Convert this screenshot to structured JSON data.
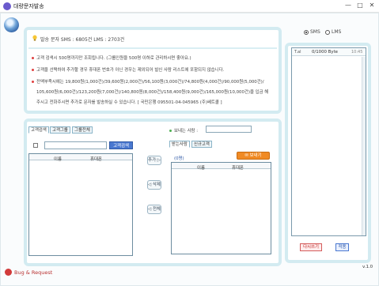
{
  "window": {
    "title": "대량문자발송",
    "minimize": "—",
    "maximize": "□",
    "close": "✕"
  },
  "info": {
    "sender": "발송 문자  SMS : 6805건  LMS : 2703건",
    "notes": [
      "고객 검색시 500명까지만 조회됩니다. (그룹인원을 500명 이하로 관리하시면 좋아요.)",
      "고객을 선택하여 추가할 경우 휴대폰 번호가 아닌 경우는 제외되어 발신 사람 리스트에 포함되지 않습니다.",
      "전액부족시에는 19,800원(1,000건)/39,600원(2,000건)/56,100원(3,000건)/74,800원(4,000건)/90,000원(5,000건)/",
      "105,600원(6,000건)/123,200원(7,000건)/140,800원(8,000건)/158,400원(9,000건)/165,000원(10,000건)을 입금 해",
      "주시고 전화주시면 추가로 문자를 발송하실 수 있습니다. [ 국민은행 095501-04-045965 (주)쎄트콜 ]"
    ]
  },
  "left": {
    "tabs": [
      "고객검색",
      "고객그룹",
      "그룹전체"
    ],
    "search_button": "고객검색",
    "columns": [
      "이름",
      "휴대폰"
    ]
  },
  "middle": {
    "add": "추가 ▷",
    "remove": "◁ 삭제",
    "remove_all": "◁ 전체"
  },
  "right": {
    "sender_label": "보내는 사람 :",
    "tabs": [
      "받는사람",
      "신규고객"
    ],
    "count": "(0명)",
    "send_button": "보내기",
    "columns": [
      "이름",
      "휴대폰"
    ]
  },
  "message": {
    "sms_label": "SMS",
    "lms_label": "LMS",
    "selected": "SMS",
    "sub_label": "T.al",
    "byte_count": "0/1000 Byte",
    "extra_label": "10:45",
    "clear_button": "다시쓰기",
    "apply_button": "적용"
  },
  "footer": {
    "brand": "Bug & Request",
    "version": "v.1.0"
  }
}
